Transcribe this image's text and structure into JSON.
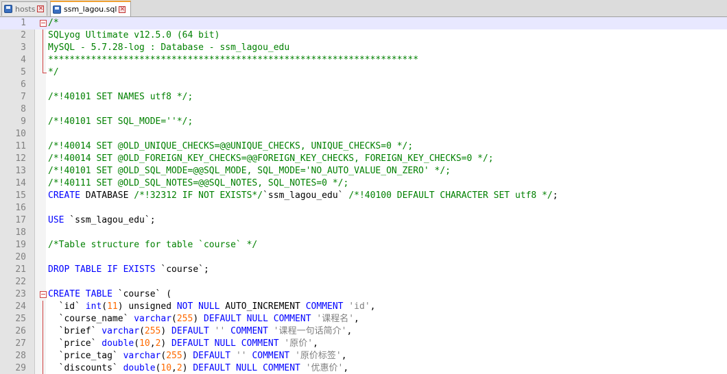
{
  "tabs": [
    {
      "label": "hosts",
      "active": false,
      "icon": "file-icon"
    },
    {
      "label": "ssm_lagou.sql",
      "active": true,
      "icon": "file-save-icon"
    }
  ],
  "colors": {
    "comment": "#008000",
    "keyword": "#0000ff",
    "number": "#ff6a00",
    "string": "#808080",
    "current_line": "#e8e8ff"
  },
  "editor": {
    "current_line": 1,
    "lines": [
      {
        "n": "1",
        "fold": "box",
        "tokens": [
          [
            "comment",
            "/*"
          ]
        ]
      },
      {
        "n": "2",
        "fold": "vline",
        "tokens": [
          [
            "comment",
            "SQLyog Ultimate v12.5.0 (64 bit)"
          ]
        ]
      },
      {
        "n": "3",
        "fold": "vline",
        "tokens": [
          [
            "comment",
            "MySQL - 5.7.28-log : Database - ssm_lagou_edu"
          ]
        ]
      },
      {
        "n": "4",
        "fold": "vline",
        "tokens": [
          [
            "comment",
            "*********************************************************************"
          ]
        ]
      },
      {
        "n": "5",
        "fold": "end",
        "tokens": [
          [
            "comment",
            "*/"
          ]
        ]
      },
      {
        "n": "6",
        "fold": "",
        "tokens": []
      },
      {
        "n": "7",
        "fold": "",
        "tokens": [
          [
            "comment",
            "/*!40101 SET NAMES utf8 */;"
          ]
        ]
      },
      {
        "n": "8",
        "fold": "",
        "tokens": []
      },
      {
        "n": "9",
        "fold": "",
        "tokens": [
          [
            "comment",
            "/*!40101 SET SQL_MODE=''*/;"
          ]
        ]
      },
      {
        "n": "10",
        "fold": "",
        "tokens": []
      },
      {
        "n": "11",
        "fold": "",
        "tokens": [
          [
            "comment",
            "/*!40014 SET @OLD_UNIQUE_CHECKS=@@UNIQUE_CHECKS, UNIQUE_CHECKS=0 */;"
          ]
        ]
      },
      {
        "n": "12",
        "fold": "",
        "tokens": [
          [
            "comment",
            "/*!40014 SET @OLD_FOREIGN_KEY_CHECKS=@@FOREIGN_KEY_CHECKS, FOREIGN_KEY_CHECKS=0 */;"
          ]
        ]
      },
      {
        "n": "13",
        "fold": "",
        "tokens": [
          [
            "comment",
            "/*!40101 SET @OLD_SQL_MODE=@@SQL_MODE, SQL_MODE='NO_AUTO_VALUE_ON_ZERO' */;"
          ]
        ]
      },
      {
        "n": "14",
        "fold": "",
        "tokens": [
          [
            "comment",
            "/*!40111 SET @OLD_SQL_NOTES=@@SQL_NOTES, SQL_NOTES=0 */;"
          ]
        ]
      },
      {
        "n": "15",
        "fold": "",
        "tokens": [
          [
            "keyword",
            "CREATE"
          ],
          [
            "plain",
            " DATABASE "
          ],
          [
            "comment",
            "/*!32312 IF NOT EXISTS*/"
          ],
          [
            "plain",
            "`ssm_lagou_edu` "
          ],
          [
            "comment",
            "/*!40100 DEFAULT CHARACTER SET utf8 */"
          ],
          [
            "plain",
            ";"
          ]
        ]
      },
      {
        "n": "16",
        "fold": "",
        "tokens": []
      },
      {
        "n": "17",
        "fold": "",
        "tokens": [
          [
            "keyword",
            "USE"
          ],
          [
            "plain",
            " `ssm_lagou_edu`;"
          ]
        ]
      },
      {
        "n": "18",
        "fold": "",
        "tokens": []
      },
      {
        "n": "19",
        "fold": "",
        "tokens": [
          [
            "comment",
            "/*Table structure for table `course` */"
          ]
        ]
      },
      {
        "n": "20",
        "fold": "",
        "tokens": []
      },
      {
        "n": "21",
        "fold": "",
        "tokens": [
          [
            "keyword",
            "DROP TABLE IF EXISTS"
          ],
          [
            "plain",
            " `course`;"
          ]
        ]
      },
      {
        "n": "22",
        "fold": "",
        "tokens": []
      },
      {
        "n": "23",
        "fold": "box",
        "tokens": [
          [
            "keyword",
            "CREATE TABLE"
          ],
          [
            "plain",
            " `course` ("
          ]
        ]
      },
      {
        "n": "24",
        "fold": "vline",
        "tokens": [
          [
            "plain",
            "  `id` "
          ],
          [
            "keyword",
            "int"
          ],
          [
            "plain",
            "("
          ],
          [
            "number",
            "11"
          ],
          [
            "plain",
            ") unsigned "
          ],
          [
            "keyword",
            "NOT NULL"
          ],
          [
            "plain",
            " AUTO_INCREMENT "
          ],
          [
            "keyword",
            "COMMENT"
          ],
          [
            "plain",
            " "
          ],
          [
            "string",
            "'id'"
          ],
          [
            "plain",
            ","
          ]
        ]
      },
      {
        "n": "25",
        "fold": "vline",
        "tokens": [
          [
            "plain",
            "  `course_name` "
          ],
          [
            "keyword",
            "varchar"
          ],
          [
            "plain",
            "("
          ],
          [
            "number",
            "255"
          ],
          [
            "plain",
            ") "
          ],
          [
            "keyword",
            "DEFAULT NULL COMMENT"
          ],
          [
            "plain",
            " "
          ],
          [
            "string",
            "'课程名'"
          ],
          [
            "plain",
            ","
          ]
        ]
      },
      {
        "n": "26",
        "fold": "vline",
        "tokens": [
          [
            "plain",
            "  `brief` "
          ],
          [
            "keyword",
            "varchar"
          ],
          [
            "plain",
            "("
          ],
          [
            "number",
            "255"
          ],
          [
            "plain",
            ") "
          ],
          [
            "keyword",
            "DEFAULT"
          ],
          [
            "plain",
            " "
          ],
          [
            "string",
            "''"
          ],
          [
            "plain",
            " "
          ],
          [
            "keyword",
            "COMMENT"
          ],
          [
            "plain",
            " "
          ],
          [
            "string",
            "'课程一句话简介'"
          ],
          [
            "plain",
            ","
          ]
        ]
      },
      {
        "n": "27",
        "fold": "vline",
        "tokens": [
          [
            "plain",
            "  `price` "
          ],
          [
            "keyword",
            "double"
          ],
          [
            "plain",
            "("
          ],
          [
            "number",
            "10"
          ],
          [
            "plain",
            ","
          ],
          [
            "number",
            "2"
          ],
          [
            "plain",
            ") "
          ],
          [
            "keyword",
            "DEFAULT NULL COMMENT"
          ],
          [
            "plain",
            " "
          ],
          [
            "string",
            "'原价'"
          ],
          [
            "plain",
            ","
          ]
        ]
      },
      {
        "n": "28",
        "fold": "vline",
        "tokens": [
          [
            "plain",
            "  `price_tag` "
          ],
          [
            "keyword",
            "varchar"
          ],
          [
            "plain",
            "("
          ],
          [
            "number",
            "255"
          ],
          [
            "plain",
            ") "
          ],
          [
            "keyword",
            "DEFAULT"
          ],
          [
            "plain",
            " "
          ],
          [
            "string",
            "''"
          ],
          [
            "plain",
            " "
          ],
          [
            "keyword",
            "COMMENT"
          ],
          [
            "plain",
            " "
          ],
          [
            "string",
            "'原价标签'"
          ],
          [
            "plain",
            ","
          ]
        ]
      },
      {
        "n": "29",
        "fold": "vline",
        "tokens": [
          [
            "plain",
            "  `discounts` "
          ],
          [
            "keyword",
            "double"
          ],
          [
            "plain",
            "("
          ],
          [
            "number",
            "10"
          ],
          [
            "plain",
            ","
          ],
          [
            "number",
            "2"
          ],
          [
            "plain",
            ") "
          ],
          [
            "keyword",
            "DEFAULT NULL COMMENT"
          ],
          [
            "plain",
            " "
          ],
          [
            "string",
            "'优惠价'"
          ],
          [
            "plain",
            ","
          ]
        ]
      }
    ]
  }
}
